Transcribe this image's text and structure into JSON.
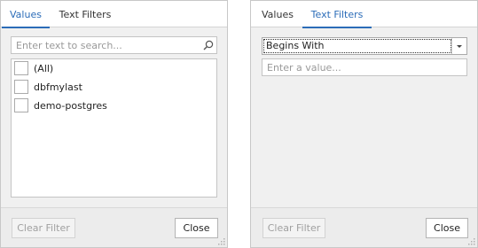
{
  "values_popup": {
    "tabs": [
      {
        "label": "Values",
        "active": true
      },
      {
        "label": "Text Filters",
        "active": false
      }
    ],
    "search": {
      "placeholder": "Enter text to search...",
      "value": "",
      "icon": "search-icon"
    },
    "items": [
      {
        "label": "(All)",
        "checked": false
      },
      {
        "label": "dbfmylast",
        "checked": false
      },
      {
        "label": "demo-postgres",
        "checked": false
      }
    ],
    "clear_filter_label": "Clear Filter",
    "clear_filter_enabled": false,
    "close_label": "Close"
  },
  "text_filters_popup": {
    "tabs": [
      {
        "label": "Values",
        "active": false
      },
      {
        "label": "Text Filters",
        "active": true
      }
    ],
    "operator": {
      "selected": "Begins With",
      "icon": "chevron-down-icon"
    },
    "value_input": {
      "placeholder": "Enter a value...",
      "value": ""
    },
    "clear_filter_label": "Clear Filter",
    "clear_filter_enabled": false,
    "close_label": "Close"
  },
  "colors": {
    "accent": "#2b6cb8",
    "panel_bg": "#f0f0f0",
    "border": "#c4c4c4",
    "disabled_text": "#a0a0a0"
  }
}
